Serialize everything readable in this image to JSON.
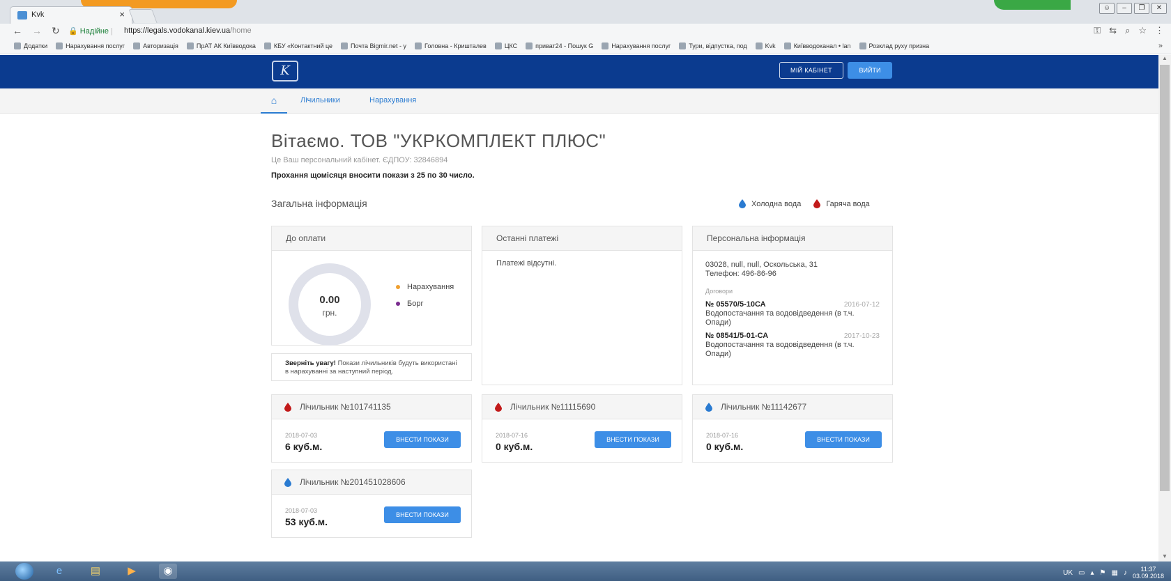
{
  "browser": {
    "tab_title": "Kvk",
    "tab_close": "×",
    "secure_label": "Надійне",
    "url_host": "https://legals.vodokanal.kiev.ua",
    "url_path": "/home",
    "bookmarks": [
      "Додатки",
      "Нарахування послуг",
      "Авторизація",
      "ПрАТ АК Київводока",
      "КБУ «Контактний це",
      "Почта Bigmir.net - у",
      "Головна - Кришталев",
      "ЦКС",
      "приват24 - Пошук G",
      "Нарахування послуг",
      "Тури, відпустка, под",
      "Kvk",
      "Київводоканал • lan",
      "Розклад руху призна"
    ],
    "bookmarks_more": "»"
  },
  "header": {
    "logo_text": "K",
    "cabinet_button": "МІЙ КАБІНЕТ",
    "exit_button": "ВИЙТИ"
  },
  "subnav": {
    "home_icon": "home-icon",
    "link_meters": "Лічильники",
    "link_charges": "Нарахування"
  },
  "main": {
    "title": "Вітаємо. ТОВ \"УКРКОМПЛЕКТ ПЛЮС\"",
    "subtitle": "Це Ваш персональний кабінет. ЄДПОУ: 32846894",
    "notice": "Прохання щомісяця вносити покази з 25 по 30 число.",
    "section_title": "Загальна інформація",
    "legend_cold": "Холодна вода",
    "legend_hot": "Гаряча вода"
  },
  "colors": {
    "cold": "#2a7bd1",
    "hot": "#c21a1a",
    "charges_dot": "#f0a030",
    "debt_dot": "#7a2c8f"
  },
  "payment_card": {
    "title": "До оплати",
    "amount": "0.00",
    "currency": "грн.",
    "legend_charges": "Нарахування",
    "legend_debt": "Борг"
  },
  "attention": {
    "bold": "Зверніть увагу!",
    "text": " Покази лічильників будуть використані в нарахуванні за наступний період."
  },
  "last_payments": {
    "title": "Останні платежі",
    "empty": "Платежі відсутні."
  },
  "personal": {
    "title": "Персональна інформація",
    "address": "03028, null, null, Оскольська, 31",
    "phone": "Телефон: 496-86-96",
    "contracts_label": "Договори",
    "contracts": [
      {
        "number": "№ 05570/5-10СА",
        "date": "2016-07-12",
        "desc": "Водопостачання та водовідведення (в т.ч. Опади)"
      },
      {
        "number": "№ 08541/5-01-СА",
        "date": "2017-10-23",
        "desc": "Водопостачання та водовідведення (в т.ч. Опади)"
      }
    ]
  },
  "meters": [
    {
      "title": "Лічильник №101741135",
      "type": "hot",
      "date": "2018-07-03",
      "value": "6 куб.м.",
      "button": "ВНЕСТИ ПОКАЗИ"
    },
    {
      "title": "Лічильник №11115690",
      "type": "hot",
      "date": "2018-07-16",
      "value": "0 куб.м.",
      "button": "ВНЕСТИ ПОКАЗИ"
    },
    {
      "title": "Лічильник №11142677",
      "type": "cold",
      "date": "2018-07-16",
      "value": "0 куб.м.",
      "button": "ВНЕСТИ ПОКАЗИ"
    },
    {
      "title": "Лічильник №201451028606",
      "type": "cold",
      "date": "2018-07-03",
      "value": "53 куб.м.",
      "button": "ВНЕСТИ ПОКАЗИ"
    }
  ],
  "taskbar": {
    "lang": "UK",
    "time": "11:37",
    "date": "03.09.2018"
  }
}
